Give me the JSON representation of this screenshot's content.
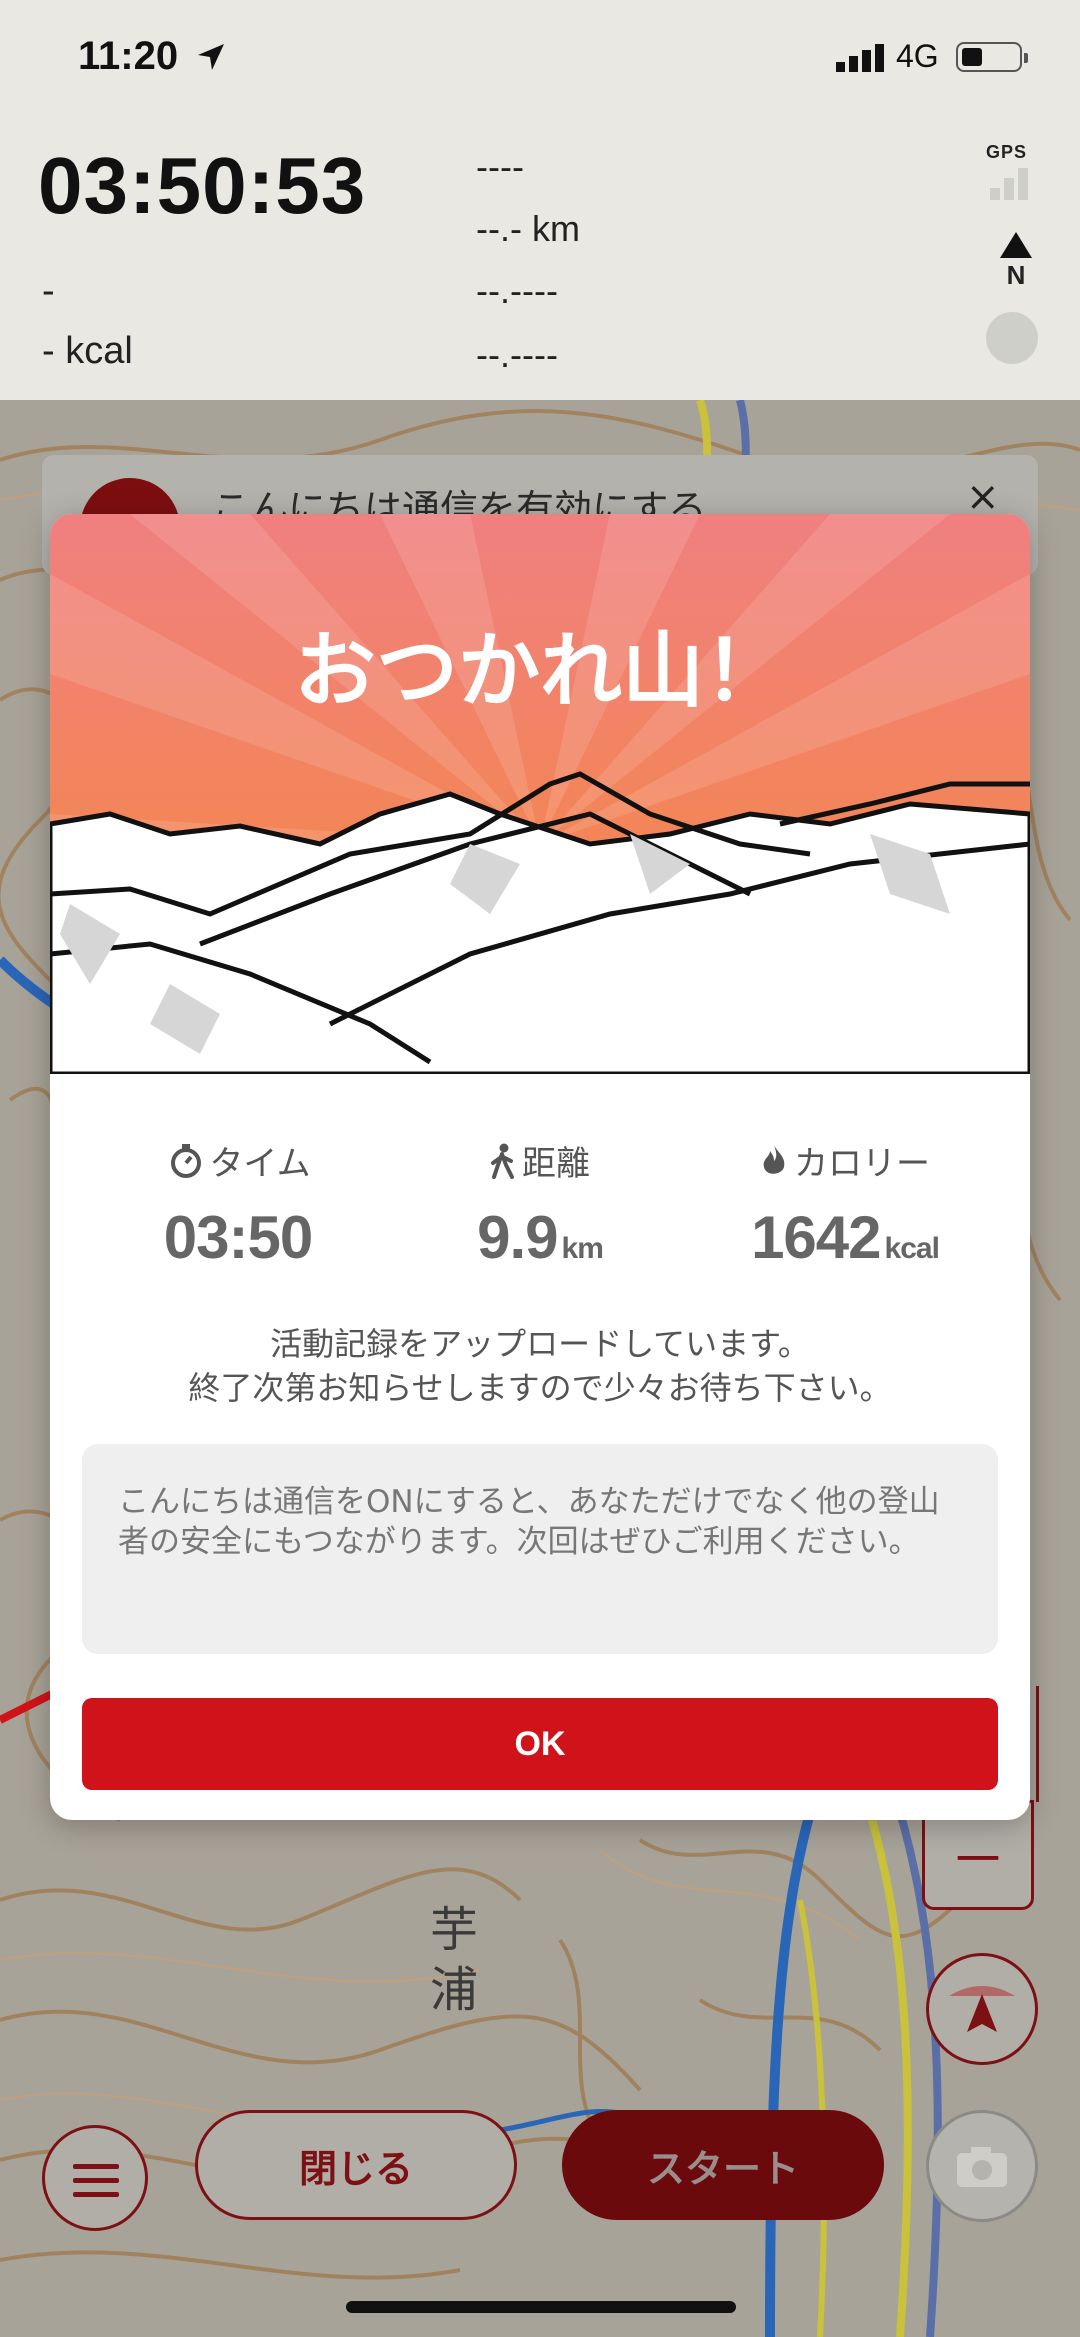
{
  "status_bar": {
    "time": "11:20",
    "network": "4G"
  },
  "tracker": {
    "elapsed": "03:50:53",
    "left_stats": [
      "-",
      "- kcal"
    ],
    "right_stats": [
      "----",
      "--.- km",
      "--.----",
      "--.----"
    ],
    "gps_label": "GPS",
    "north_label": "N"
  },
  "banner": {
    "text": "こんにちは通信を有効にする",
    "close": "×"
  },
  "map": {
    "label_name": "芋浦"
  },
  "modal": {
    "title": "おつかれ山！",
    "stats": [
      {
        "icon": "stopwatch-icon",
        "label": "タイム",
        "value": "03:50",
        "unit": ""
      },
      {
        "icon": "walker-icon",
        "label": "距離",
        "value": "9.9",
        "unit": "km"
      },
      {
        "icon": "flame-icon",
        "label": "カロリー",
        "value": "1642",
        "unit": "kcal"
      }
    ],
    "upload_line1": "活動記録をアップロードしています。",
    "upload_line2": "終了次第お知らせしますので少々お待ち下さい。",
    "info": "こんにちは通信をONにすると、あなただけでなく他の登山者の安全にもつながります。次回はぜひご利用ください。",
    "ok": "OK"
  },
  "controls": {
    "close": "閉じる",
    "start": "スタート",
    "zoom_out": "－"
  },
  "colors": {
    "accent": "#d0131b",
    "dark_red": "#7c1014",
    "sunset_top": "#f08080",
    "sunset_bottom": "#f5893a"
  }
}
